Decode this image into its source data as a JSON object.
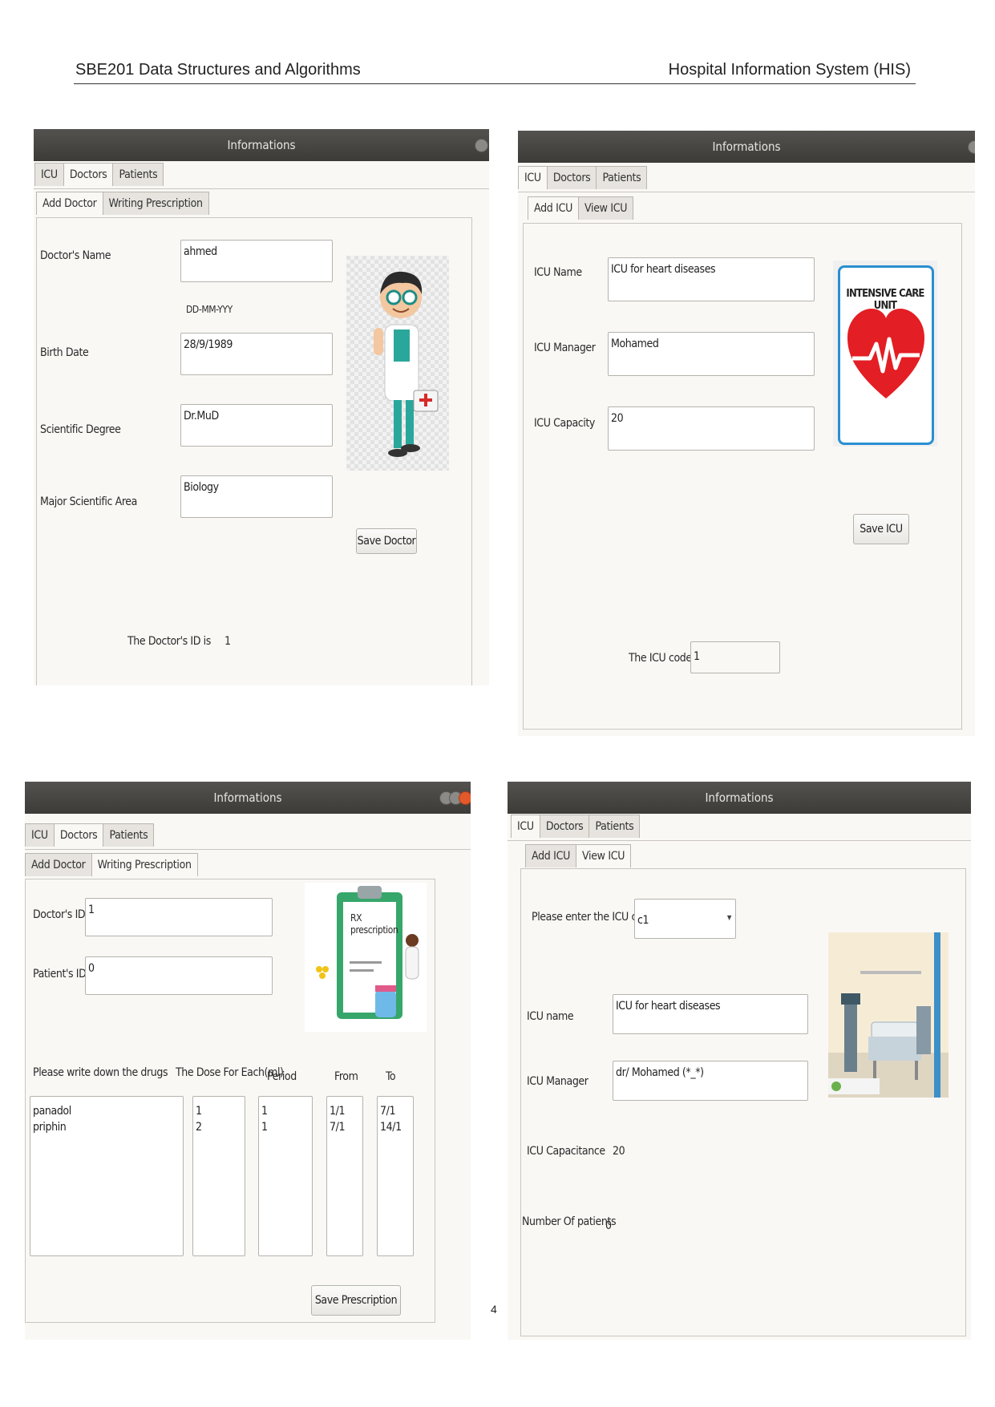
{
  "doc": {
    "header_left": "SBE201 Data Structures and Algorithms",
    "header_right": "Hospital Information System (HIS)",
    "page_number": "4"
  },
  "win1": {
    "title": "Informations",
    "tabs": [
      "ICU",
      "Doctors",
      "Patients"
    ],
    "subtabs": [
      "Add Doctor",
      "Writing Prescription"
    ],
    "doctor_name_label": "Doctor's Name",
    "doctor_name_value": "ahmed",
    "date_format_hint": "DD-MM-YYY",
    "birth_date_label": "Birth Date",
    "birth_date_value": "28/9/1989",
    "degree_label": "Scientific Degree",
    "degree_value": "Dr.MuD",
    "area_label": "Major Scientific Area",
    "area_value": "Biology",
    "save_button": "Save Doctor",
    "id_label": "The Doctor's ID is",
    "id_value": "1"
  },
  "win2": {
    "title": "Informations",
    "tabs": [
      "ICU",
      "Doctors",
      "Patients"
    ],
    "subtabs": [
      "Add ICU",
      "View ICU"
    ],
    "name_label": "ICU Name",
    "name_value": "ICU for heart diseases",
    "manager_label": "ICU Manager",
    "manager_value": "Mohamed",
    "capacity_label": "ICU Capacity",
    "capacity_value": "20",
    "sign_text": "INTENSIVE CARE UNIT",
    "save_button": "Save ICU",
    "code_label": "The ICU code is",
    "code_value": "1"
  },
  "win3": {
    "title": "Informations",
    "tabs": [
      "ICU",
      "Doctors",
      "Patients"
    ],
    "subtabs": [
      "Add Doctor",
      "Writing Prescription"
    ],
    "doctor_id_label": "Doctor's ID",
    "doctor_id_value": "1",
    "patient_id_label": "Patient's ID",
    "patient_id_value": "0",
    "rx_text": "RX\nprescription",
    "drugs_label": "Please write down the drugs",
    "dose_label": "The Dose For Each(ml)",
    "period_label": "Period",
    "from_label": "From",
    "to_label": "To",
    "drugs_value": "panadol\npriphin",
    "dose_value": "1\n2",
    "period_value": "1\n1",
    "from_value": "1/1\n7/1",
    "to_value": "7/1\n14/1",
    "save_button": "Save Prescription"
  },
  "win4": {
    "title": "Informations",
    "tabs": [
      "ICU",
      "Doctors",
      "Patients"
    ],
    "subtabs": [
      "Add ICU",
      "View ICU"
    ],
    "code_prompt": "Please enter the ICU code",
    "code_select_value": "c1",
    "name_label": "ICU name",
    "name_value": "ICU for heart diseases",
    "manager_label": "ICU Manager",
    "manager_value": "dr/ Mohamed (*_*)",
    "capacitance_label": "ICU Capacitance",
    "capacitance_value": "20",
    "patients_label": "Number Of patients",
    "patients_value": "0"
  }
}
